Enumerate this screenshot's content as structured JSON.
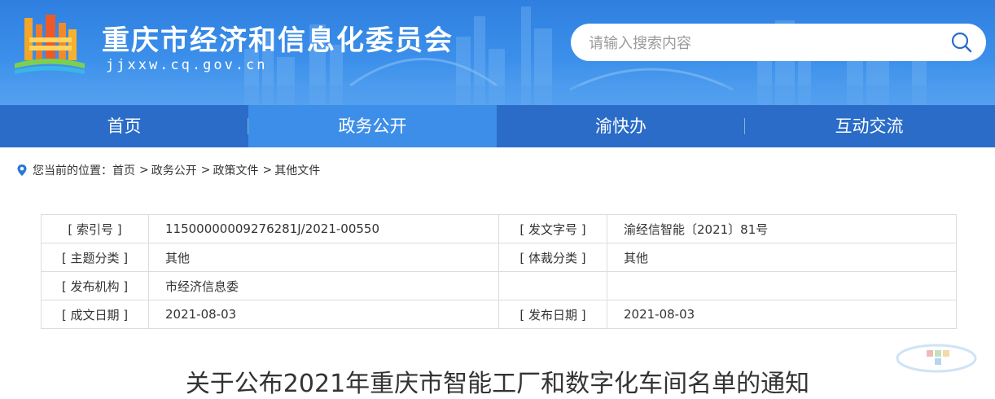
{
  "header": {
    "site_title": "重庆市经济和信息化委员会",
    "site_url": "jjxxw.cq.gov.cn",
    "search_placeholder": "请输入搜索内容",
    "logo_icon": "government-building-logo",
    "search_icon": "search-icon"
  },
  "nav": {
    "items": [
      {
        "label": "首页",
        "active": false
      },
      {
        "label": "政务公开",
        "active": true
      },
      {
        "label": "渝快办",
        "active": false
      },
      {
        "label": "互动交流",
        "active": false
      }
    ]
  },
  "breadcrumb": {
    "icon": "location-pin-icon",
    "prefix": "您当前的位置：",
    "items": [
      "首页",
      "政务公开",
      "政策文件",
      "其他文件"
    ],
    "separator": ">"
  },
  "info_table": {
    "rows": [
      {
        "label1": "[ 索引号 ]",
        "value1": "11500000009276281J/2021-00550",
        "label2": "[ 发文字号 ]",
        "value2": "渝经信智能〔2021〕81号"
      },
      {
        "label1": "[ 主题分类 ]",
        "value1": "其他",
        "label2": "[ 体裁分类 ]",
        "value2": "其他"
      },
      {
        "label1": "[ 发布机构 ]",
        "value1": "市经济信息委",
        "label2": "",
        "value2": ""
      },
      {
        "label1": "[ 成文日期 ]",
        "value1": "2021-08-03",
        "label2": "[ 发布日期 ]",
        "value2": "2021-08-03"
      }
    ]
  },
  "document": {
    "title": "关于公布2021年重庆市智能工厂和数字化车间名单的通知"
  },
  "colors": {
    "header_blue": "#3b8fea",
    "nav_blue": "#2a6cc8",
    "nav_active": "#3d8ee8",
    "pin_blue": "#2a78d6"
  }
}
